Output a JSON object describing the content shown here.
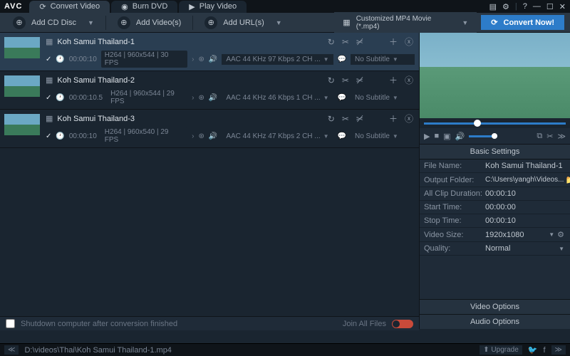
{
  "app": {
    "logo": "AVC"
  },
  "tabs": [
    {
      "label": "Convert Video",
      "active": true
    },
    {
      "label": "Burn DVD",
      "active": false
    },
    {
      "label": "Play Video",
      "active": false
    }
  ],
  "toolbar": {
    "add_cd": "Add CD Disc",
    "add_videos": "Add Video(s)",
    "add_urls": "Add URL(s)",
    "profile": "Customized MP4 Movie (*.mp4)",
    "convert": "Convert Now!"
  },
  "files": [
    {
      "name": "Koh Samui Thailand-1",
      "duration": "00:00:10",
      "vinfo": "H264 | 960x544 | 30 FPS",
      "audio": "AAC 44 KHz 97 Kbps 2 CH ...",
      "subtitle": "No Subtitle",
      "selected": true
    },
    {
      "name": "Koh Samui Thailand-2",
      "duration": "00:00:10.5",
      "vinfo": "H264 | 960x544 | 29 FPS",
      "audio": "AAC 44 KHz 46 Kbps 1 CH ...",
      "subtitle": "No Subtitle",
      "selected": false
    },
    {
      "name": "Koh Samui Thailand-3",
      "duration": "00:00:10",
      "vinfo": "H264 | 960x540 | 29 FPS",
      "audio": "AAC 44 KHz 47 Kbps 2 CH ...",
      "subtitle": "No Subtitle",
      "selected": false
    }
  ],
  "listfoot": {
    "shutdown": "Shutdown computer after conversion finished",
    "join": "Join All Files"
  },
  "preview": {
    "basic_heading": "Basic Settings",
    "rows": {
      "filename_lbl": "File Name:",
      "filename_val": "Koh Samui Thailand-1",
      "output_lbl": "Output Folder:",
      "output_val": "C:\\Users\\yangh\\Videos...",
      "duration_lbl": "All Clip Duration:",
      "duration_val": "00:00:10",
      "start_lbl": "Start Time:",
      "start_val": "00:00:00",
      "stop_lbl": "Stop Time:",
      "stop_val": "00:00:10",
      "size_lbl": "Video Size:",
      "size_val": "1920x1080",
      "quality_lbl": "Quality:",
      "quality_val": "Normal"
    },
    "video_options": "Video Options",
    "audio_options": "Audio Options"
  },
  "status": {
    "path": "D:\\videos\\Thai\\Koh Samui Thailand-1.mp4",
    "upgrade": "Upgrade"
  }
}
